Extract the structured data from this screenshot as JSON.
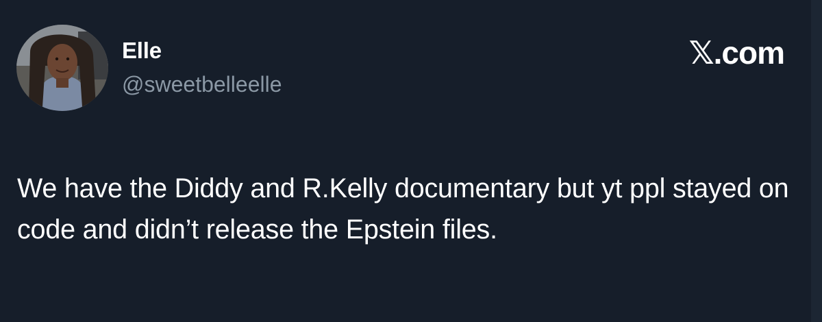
{
  "author": {
    "display_name": "Elle",
    "handle": "@sweetbelleelle",
    "avatar_icon": "profile-photo"
  },
  "brand": {
    "x_glyph": "𝕏",
    "domain_suffix": ".com"
  },
  "tweet": {
    "text": "We have the Diddy and R.Kelly documentary but yt ppl stayed on code and didn’t release the Epstein files."
  },
  "colors": {
    "background": "#161e2a",
    "handle": "#8b98a5",
    "text": "#ffffff"
  }
}
